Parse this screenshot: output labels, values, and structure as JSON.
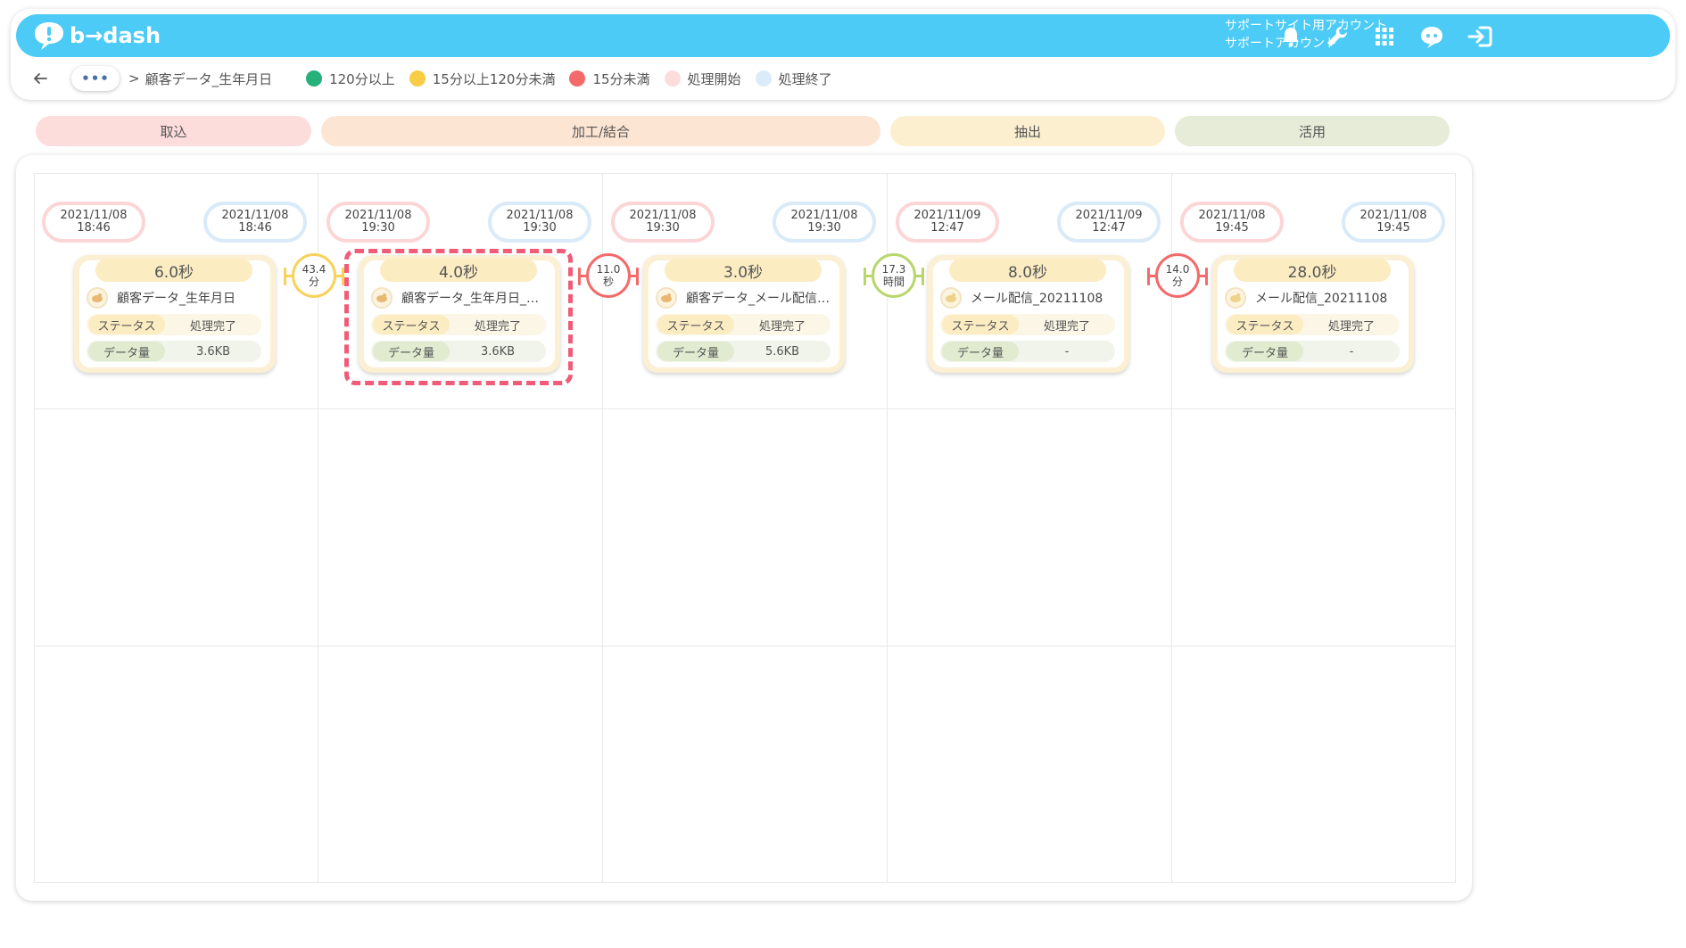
{
  "header": {
    "logo_text": "b→dash",
    "account_line1": "サポートサイト用アカウント",
    "account_line2": "サポートアカウント",
    "icons": [
      "bell-icon",
      "wrench-icon",
      "grid-menu-icon",
      "chat-bot-icon",
      "logout-icon"
    ]
  },
  "breadcrumb": {
    "more": "•••",
    "separator": ">",
    "current": "顧客データ_生年月日"
  },
  "legend": [
    {
      "label": "120分以上",
      "color": "#26b07a"
    },
    {
      "label": "15分以上120分未満",
      "color": "#f8cc45"
    },
    {
      "label": "15分未満",
      "color": "#f36a6a"
    },
    {
      "label": "処理開始",
      "color": "#fddcdc"
    },
    {
      "label": "処理終了",
      "color": "#dcebf9"
    }
  ],
  "phases": [
    {
      "label": "取込",
      "color": "#fddcdc"
    },
    {
      "label": "加工/結合",
      "color": "#fde5d3"
    },
    {
      "label": "抽出",
      "color": "#fbefcf"
    },
    {
      "label": "活用",
      "color": "#e6ecd8"
    }
  ],
  "nodes": [
    {
      "start_date": "2021/11/08",
      "start_time": "18:46",
      "end_date": "2021/11/08",
      "end_time": "18:46",
      "duration": "6.0秒",
      "name": "顧客データ_生年月日",
      "status_label": "ステータス",
      "status": "処理完了",
      "volume_label": "データ量",
      "volume": "3.6KB"
    },
    {
      "start_date": "2021/11/08",
      "start_time": "19:30",
      "end_date": "2021/11/08",
      "end_time": "19:30",
      "duration": "4.0秒",
      "name": "顧客データ_生年月日_2…",
      "status_label": "ステータス",
      "status": "処理完了",
      "volume_label": "データ量",
      "volume": "3.6KB"
    },
    {
      "start_date": "2021/11/08",
      "start_time": "19:30",
      "end_date": "2021/11/08",
      "end_time": "19:30",
      "duration": "3.0秒",
      "name": "顧客データ_メール配信…",
      "status_label": "ステータス",
      "status": "処理完了",
      "volume_label": "データ量",
      "volume": "5.6KB"
    },
    {
      "start_date": "2021/11/09",
      "start_time": "12:47",
      "end_date": "2021/11/09",
      "end_time": "12:47",
      "duration": "8.0秒",
      "name": "メール配信_20211108",
      "status_label": "ステータス",
      "status": "処理完了",
      "volume_label": "データ量",
      "volume": "-"
    },
    {
      "start_date": "2021/11/08",
      "start_time": "19:45",
      "end_date": "2021/11/08",
      "end_time": "19:45",
      "duration": "28.0秒",
      "name": "メール配信_20211108",
      "status_label": "ステータス",
      "status": "処理完了",
      "volume_label": "データ量",
      "volume": "-"
    }
  ],
  "connectors": [
    {
      "value": "43.4",
      "unit": "分",
      "color": "#f8d25a"
    },
    {
      "value": "11.0",
      "unit": "秒",
      "color": "#f36a6a"
    },
    {
      "value": "17.3",
      "unit": "時間",
      "color": "#b9d66c"
    },
    {
      "value": "14.0",
      "unit": "分",
      "color": "#f36a6a"
    }
  ]
}
